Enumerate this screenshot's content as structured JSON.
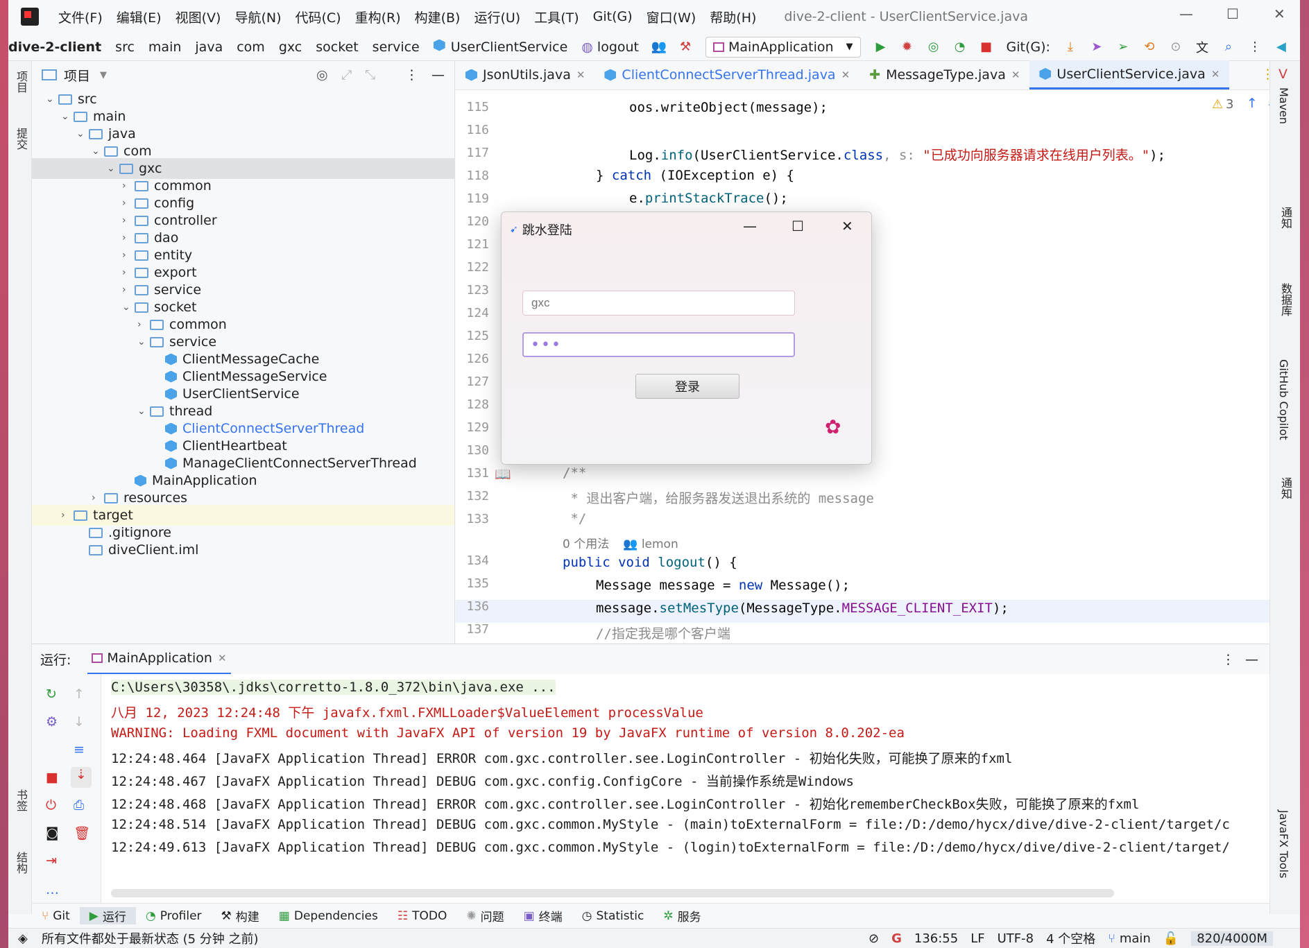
{
  "menubar": {
    "items": [
      "文件(F)",
      "编辑(E)",
      "视图(V)",
      "导航(N)",
      "代码(C)",
      "重构(R)",
      "构建(B)",
      "运行(U)",
      "工具(T)",
      "Git(G)",
      "窗口(W)",
      "帮助(H)"
    ],
    "title": "dive-2-client - UserClientService.java"
  },
  "nav": {
    "project": "dive-2-client",
    "crumbs": [
      "src",
      "main",
      "java",
      "com",
      "gxc",
      "socket",
      "service"
    ],
    "class": "UserClientService",
    "method": "logout",
    "run_config": "MainApplication",
    "git_label": "Git(G):"
  },
  "project_panel": {
    "title": "项目",
    "tree": [
      {
        "label": "src",
        "indent": 0
      },
      {
        "label": "main",
        "indent": 1
      },
      {
        "label": "java",
        "indent": 2
      },
      {
        "label": "com",
        "indent": 3
      },
      {
        "label": "gxc",
        "indent": 4
      },
      {
        "label": "common",
        "indent": 5
      },
      {
        "label": "config",
        "indent": 5
      },
      {
        "label": "controller",
        "indent": 5
      },
      {
        "label": "dao",
        "indent": 5
      },
      {
        "label": "entity",
        "indent": 5
      },
      {
        "label": "export",
        "indent": 5
      },
      {
        "label": "service",
        "indent": 5
      },
      {
        "label": "socket",
        "indent": 5
      },
      {
        "label": "common",
        "indent": 6
      },
      {
        "label": "service",
        "indent": 6
      },
      {
        "label": "ClientMessageCache",
        "indent": 7
      },
      {
        "label": "ClientMessageService",
        "indent": 7
      },
      {
        "label": "UserClientService",
        "indent": 7
      },
      {
        "label": "thread",
        "indent": 6
      },
      {
        "label": "ClientConnectServerThread",
        "indent": 7
      },
      {
        "label": "ClientHeartbeat",
        "indent": 7
      },
      {
        "label": "ManageClientConnectServerThread",
        "indent": 7
      },
      {
        "label": "MainApplication",
        "indent": 5
      },
      {
        "label": "resources",
        "indent": 3
      },
      {
        "label": "target",
        "indent": 1
      },
      {
        "label": ".gitignore",
        "indent": 2
      },
      {
        "label": "diveClient.iml",
        "indent": 2
      }
    ]
  },
  "tabs": [
    "JsonUtils.java",
    "ClientConnectServerThread.java",
    "MessageType.java",
    "UserClientService.java"
  ],
  "editor": {
    "warnings": "3",
    "usage": "0 个用法",
    "author": "lemon",
    "lines": [
      "115",
      "116",
      "117",
      "118",
      "119",
      "120",
      "121",
      "122",
      "123",
      "124",
      "125",
      "126",
      "127",
      "128",
      "129",
      "130",
      "131",
      "132",
      "133",
      "134",
      "135",
      "136",
      "137"
    ],
    "code": {
      "l115": "oos.writeObject(message);",
      "l117a": "Log.",
      "l117b": "info",
      "l117c": "(UserClientService.",
      "l117d": "class",
      "l117e": ", s: ",
      "l117f": "\"已成功向服务器请求在线用户列表。\"",
      "l117g": ");",
      "l118a": "} ",
      "l118b": "catch",
      "l118c": " (IOException e) {",
      "l119a": "e.",
      "l119b": "printStackTrace",
      "l119c": "();",
      "l131": "/**",
      "l132": " * 退出客户端，给服务器发送退出系统的 message",
      "l133": " */",
      "l134a": "public void ",
      "l134b": "logout",
      "l134c": "() {",
      "l135a": "Message message = ",
      "l135b": "new",
      "l135c": " Message();",
      "l136a": "message.",
      "l136b": "setMesType",
      "l136c": "(MessageType.",
      "l136d": "MESSAGE_CLIENT_EXIT",
      "l136e": ");",
      "l137": "//指定我是哪个客户端"
    }
  },
  "dialog": {
    "title": "跳水登陆",
    "username_placeholder": "gxc",
    "password_mask": "•••",
    "login_label": "登录"
  },
  "run": {
    "label": "运行:",
    "tab": "MainApplication",
    "lines": [
      "C:\\Users\\30358\\.jdks\\corretto-1.8.0_372\\bin\\java.exe ...",
      "八月 12, 2023 12:24:48 下午 javafx.fxml.FXMLLoader$ValueElement processValue",
      "WARNING: Loading FXML document with JavaFX API of version 19 by JavaFX runtime of version 8.0.202-ea",
      "12:24:48.464 [JavaFX Application Thread] ERROR com.gxc.controller.see.LoginController - 初始化失败，可能换了原来的fxml",
      "12:24:48.467 [JavaFX Application Thread] DEBUG com.gxc.config.ConfigCore - 当前操作系统是Windows",
      "12:24:48.468 [JavaFX Application Thread] ERROR com.gxc.controller.see.LoginController - 初始化rememberCheckBox失败，可能换了原来的fxml",
      "12:24:48.514 [JavaFX Application Thread] DEBUG com.gxc.common.MyStyle - (main)toExternalForm = file:/D:/demo/hycx/dive/dive-2-client/target/c",
      "12:24:49.613 [JavaFX Application Thread] DEBUG com.gxc.common.MyStyle - (login)toExternalForm = file:/D:/demo/hycx/dive/dive-2-client/target/"
    ]
  },
  "bottom_tabs": [
    "Git",
    "运行",
    "Profiler",
    "构建",
    "Dependencies",
    "TODO",
    "问题",
    "终端",
    "Statistic",
    "服务"
  ],
  "left_stripe": [
    "项目",
    "提交",
    "书签",
    "结构"
  ],
  "right_stripe": [
    "Maven",
    "通知",
    "数据库",
    "GitHub Copilot",
    "通知",
    "JavaFX Tools"
  ],
  "status": {
    "message": "所有文件都处于最新状态 (5 分钟 之前)",
    "position": "136:55",
    "line_sep": "LF",
    "encoding": "UTF-8",
    "indent": "4 个空格",
    "branch": "main",
    "memory": "820/4000M"
  }
}
